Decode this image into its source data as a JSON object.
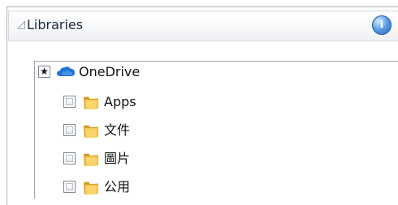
{
  "header": {
    "collapse_glyph": "◿",
    "title": "Libraries",
    "info_glyph": "i",
    "info_icon": "info-icon"
  },
  "tree": {
    "root": {
      "label": "OneDrive",
      "checkbox_state": "star",
      "checkbox_glyph": "★",
      "icon": "cloud-icon",
      "color": "#1e73d6"
    },
    "children": [
      {
        "label": "Apps",
        "checked": false,
        "icon": "folder-icon"
      },
      {
        "label": "文件",
        "checked": false,
        "icon": "folder-icon"
      },
      {
        "label": "圖片",
        "checked": false,
        "icon": "folder-icon"
      },
      {
        "label": "公用",
        "checked": false,
        "icon": "folder-icon"
      }
    ]
  },
  "colors": {
    "panel_border": "#a8b0bc",
    "tree_border": "#9aa3ad",
    "folder_yellow": "#f3c94a",
    "folder_dark": "#d59a22",
    "onedrive_blue": "#1e73d6",
    "info_blue": "#2b61a8"
  }
}
